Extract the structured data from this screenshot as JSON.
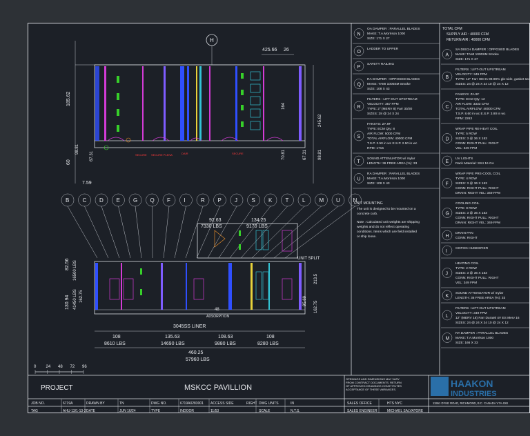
{
  "title_block": {
    "project_label": "PROJECT",
    "project_name": "MSKCC PAVILLION",
    "disclaimer": [
      "OPENINGS AND DIMENSIONS MAY VARY",
      "FROM CONTRACT DOCUMENTS. RETURN",
      "OF APPROVED DRAWINGS CONSTITUTES",
      "ACCEPTANCE OF THESE VARIANCES."
    ],
    "fields": {
      "job_no_label": "JOB NO.",
      "job_no": "6719A",
      "tag_label": "TAG",
      "tag": "AHU-13/1-13-2",
      "drawn_by_label": "DRAWN BY",
      "drawn_by": "TN",
      "date_label": "DATE",
      "date": "JUN 16/24",
      "dwg_no_label": "DWG NO.",
      "dwg_no": "6719A0283001",
      "type_label": "TYPE",
      "type": "INDOOR",
      "access_side_label": "ACCESS SIDE",
      "access_side": "RIGHT",
      "sheet_ref": "11/53",
      "dwg_units_label": "DWG UNITS",
      "dwg_units": "IN",
      "scale_label": "SCALE",
      "scale": "N.T.S.",
      "sales_office_label": "SALES OFFICE",
      "sales_office": "HTS NYC",
      "sales_engineer_label": "SALES ENGINEER",
      "sales_engineer": "MICHAEL SALVATORE"
    },
    "company_line1": "HAAKON",
    "company_line2": "INDUSTRIES",
    "company_address": "11551 DYKE ROAD, RICHMOND, B.C. CANADA V7A 4X8"
  },
  "scale_bar": [
    "0",
    "24",
    "48",
    "72",
    "96"
  ],
  "dimensions": {
    "top_col": "H",
    "top_w1": "425.66",
    "top_w2": "26",
    "left_h1": "185.62",
    "left_h2": "98.81",
    "left_h3": "60",
    "left_h4": "67.31",
    "left_h5": "7.59",
    "right_h1": "164",
    "right_h2": "245.62",
    "right_h3": "70.81",
    "right_h4": "67.31",
    "right_h5": "98.81",
    "upper_w1": "92.63",
    "upper_w2": "134.25",
    "upper_lbs1": "7330 LBS",
    "upper_lbs2": "9170 LBS",
    "left_h6": "82.56",
    "left_lbs_v": "16500 LBS",
    "left_h7": "130.94",
    "left_h8": "162.75",
    "left_lbs_v2": "41450 LBS",
    "right_h6": "213.5",
    "right_h7": "95.69",
    "right_h8": "162.75",
    "adsorption": "ADSORPTION",
    "adsorption_w": "48",
    "liner": "3045SS LINER",
    "bottom_w1": "108",
    "bottom_w2": "135.63",
    "bottom_w3": "108.63",
    "bottom_w4": "108",
    "bottom_lbs1": "8610 LBS",
    "bottom_lbs2": "14690 LBS",
    "bottom_lbs3": "9880 LBS",
    "bottom_lbs4": "8280 LBS",
    "total_w": "460.25",
    "total_lbs": "57960 LBS",
    "split": "UNIT SPLIT"
  },
  "callout_letters": [
    "B",
    "C",
    "D",
    "E",
    "G",
    "Q",
    "F",
    "I",
    "R",
    "P",
    "J",
    "S",
    "K",
    "T",
    "L",
    "M",
    "U",
    "N"
  ],
  "col_mid": [
    {
      "letter": "N",
      "lines": [
        "OA DAMPER : PARALLEL BLADES",
        "MAKE:    T.A.Morrison 1000",
        "SIZE:    171 X 27"
      ]
    },
    {
      "letter": "O",
      "lines": [
        "LADDER TO UPPER"
      ]
    },
    {
      "letter": "P",
      "lines": [
        "SAFETY RAILING"
      ]
    },
    {
      "letter": "Q",
      "lines": [
        "RA DAMPER : OPPOSED BLADES",
        "MAKE:    TAMI 1000SM Smoke",
        "SIZE:    108 X 43"
      ]
    },
    {
      "letter": "R",
      "lines": [
        "FILTERS : LIFT-OUT UPSTREAM",
        "VELOCITY:    357 FPM",
        "TYPE:    2\" (MERV 8) Farr 30/30",
        "SIZES:    28 @ 24 X 24"
      ]
    },
    {
      "letter": "S",
      "lines": [
        "FANSYS:  ZA 9F",
        "TYPE:  ECM          Qty:  8",
        "AIR FLOW:    5000 CFM",
        "TOTAL AIRFLOW:    40000 CFM",
        "T.S.P.   2.50 in wc     E.S.P.  2.50 in wc",
        "RPM:    1715"
      ]
    },
    {
      "letter": "T",
      "lines": [
        "SOUND ATTENUATOR  w/ mylar",
        "LENGTH:  36    FREE AREA (%):   33"
      ]
    },
    {
      "letter": "U",
      "lines": [
        "RA DAMPER : PARALLEL BLADES",
        "MAKE:    T.A.Morrison 1000",
        "SIZE:    108 X 43"
      ]
    }
  ],
  "mounting": {
    "title": "UNIT MOUNTING",
    "lines": [
      "The unit is designed to be mounted on a",
      "concrete curb."
    ],
    "note": [
      "Note : Calculated unit weights are shipping",
      "weights and do not reflect operating",
      "conditions. Items which are field installed",
      "or ship loose."
    ]
  },
  "col_right_header": [
    "TOTAL CFM",
    "SUPPLY AIR :  40000 CFM",
    "RETURN AIR :  40000 CFM"
  ],
  "col_right": [
    {
      "letter": "A",
      "lines": [
        "SA DISCH DAMPER : OPPOSED BLADES",
        "MAKE:    TAMI 1000SM Smoke",
        "SIZE:    171 X 27"
      ]
    },
    {
      "letter": "B",
      "lines": [
        "FILTERS : LIFT-OUT UPSTREAM",
        "VELOCITY:    349 FPM",
        "TYPE:  12\" Farr HEHA 99.99% glo-side, gasket seal",
        "SIZES:  24 @ 24 X 24          10 @ 24 X 12"
      ]
    },
    {
      "letter": "C",
      "lines": [
        "FANSYS:  ZA 9F",
        "TYPE:  ECM          Qty:  12",
        "AIR FLOW:    3333 CFM",
        "TOTAL AIRFLOW:    40000 CFM",
        "T.S.P.  8.60 in wc     E.S.P.  3.90 in wc",
        "RPM:  2263"
      ]
    },
    {
      "letter": "D",
      "lines": [
        "WRAP PIPE RE-HEAT COIL",
        "TYPE:    5 ROW",
        "SIZES:   3 @ 36 X 153",
        "CONN:    RIGHT          PULL:  RIGHT",
        "VEL:     349 FPM"
      ]
    },
    {
      "letter": "E",
      "lines": [
        "UV LIGHTS",
        "Rack Material: SS4 16 GA"
      ]
    },
    {
      "letter": "F",
      "lines": [
        "WRAP PIPE PRE-COOL COIL",
        "TYPE:    4 ROW",
        "SIZES:   3 @ 36 X 153",
        "CONN:    RIGHT          PULL:  RIGHT",
        "DRAIN:   RIGHT          VEL:  349 FPM"
      ]
    },
    {
      "letter": "G",
      "lines": [
        "COOLING COIL",
        "TYPE:    8 ROW",
        "SIZES:   3 @ 36 X 153",
        "CONN:    RIGHT          PULL:  RIGHT",
        "DRAIN:   RIGHT          VEL:  349 FPM"
      ]
    },
    {
      "letter": "H",
      "lines": [
        "DRAIN PAN",
        "CONN:  RIGHT"
      ]
    },
    {
      "letter": "I",
      "lines": [
        "GOFOG HUMIDIFIER"
      ]
    },
    {
      "letter": "J",
      "lines": [
        "HEATING COIL",
        "TYPE:    2 ROW",
        "SIZES:   3 @ 36 X 153",
        "CONN:    RIGHT          PULL:  RIGHT",
        "VEL:     349 FPM"
      ]
    },
    {
      "letter": "K",
      "lines": [
        "SOUND ATTENUATOR  w/ mylar",
        "LENGTH:  36        FREE AREA (%):   33"
      ]
    },
    {
      "letter": "L",
      "lines": [
        "FILTERS : LIFT-OUT UPSTREAM",
        "VELOCITY:    349 FPM",
        "12\" (MERV 16) Farr DuraMi 4V ES Merv 16",
        "SIZES:  24 @ 24 X 24          10 @ 24 X 12"
      ]
    },
    {
      "letter": "M",
      "lines": [
        "RA DAMPER : PARALLEL BLADES",
        "MAKE:    T.A.Morrison 1000",
        "SIZE:    166 X 33"
      ]
    }
  ],
  "colors": {
    "bg": "#2d3136",
    "sheet": "#1c2027",
    "line": "#d9dce1",
    "blue": "#2f4fff",
    "green": "#37d02a",
    "magenta": "#d33bd6",
    "red": "#ff3b3b",
    "cyan": "#33c3d4",
    "yellow": "#e8d23a",
    "orange": "#e08a2a",
    "purple": "#7e5cff"
  }
}
